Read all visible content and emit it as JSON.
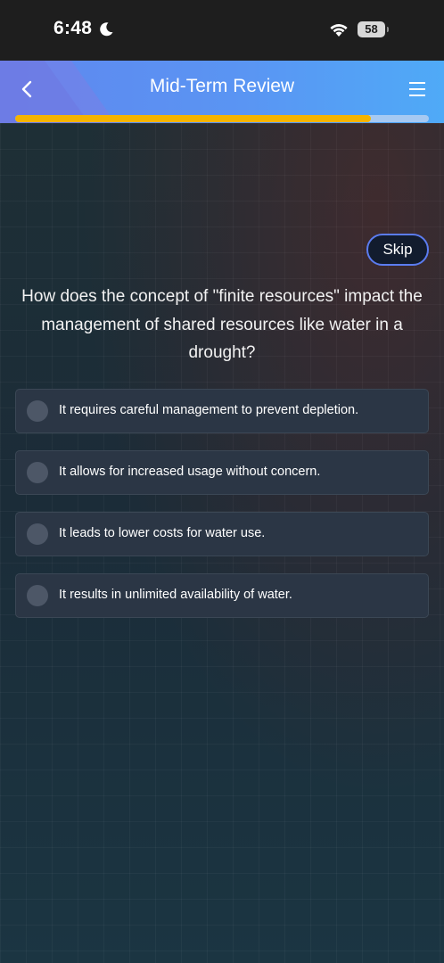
{
  "status_bar": {
    "time": "6:48",
    "battery": "58",
    "icons": [
      "moon-icon",
      "wifi-icon",
      "battery-icon"
    ]
  },
  "header": {
    "title": "Mid-Term Review",
    "back_icon": "chevron-left-icon",
    "menu_icon": "hamburger-menu-icon",
    "accent_color": "#5a95f3",
    "progress_fraction": 0.86,
    "progress_color": "#f5b400"
  },
  "quiz": {
    "skip_label": "Skip",
    "question": "How does the concept of \"finite resources\" impact the management of shared resources like water in a drought?",
    "options": [
      {
        "label": "It requires careful management to prevent depletion."
      },
      {
        "label": "It allows for increased usage without concern."
      },
      {
        "label": "It leads to lower costs for water use."
      },
      {
        "label": "It results in unlimited availability of water."
      }
    ]
  }
}
